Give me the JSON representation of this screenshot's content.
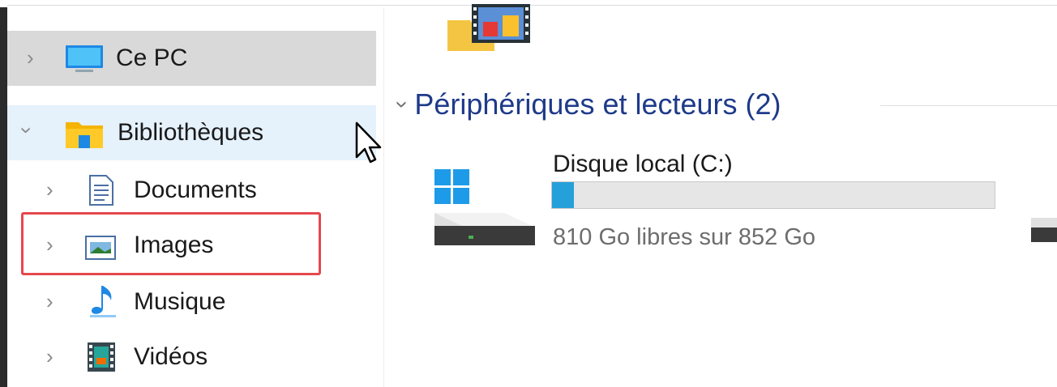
{
  "nav": {
    "items": [
      {
        "label": "Ce PC",
        "icon": "computer-icon",
        "expanded": false,
        "state": "selected"
      },
      {
        "label": "Bibliothèques",
        "icon": "libraries-folder-icon",
        "expanded": true,
        "state": "hover"
      },
      {
        "label": "Documents",
        "icon": "documents-icon",
        "expanded": false
      },
      {
        "label": "Images",
        "icon": "images-icon",
        "expanded": false,
        "highlighted": true
      },
      {
        "label": "Musique",
        "icon": "music-icon",
        "expanded": false
      },
      {
        "label": "Vidéos",
        "icon": "videos-icon",
        "expanded": false
      }
    ]
  },
  "main": {
    "group": {
      "title": "Périphériques et lecteurs (2)"
    },
    "drive": {
      "name": "Disque local (C:)",
      "info": "810 Go libres sur 852 Go",
      "used_fraction": 0.049,
      "icon": "windows-drive-icon"
    }
  },
  "colors": {
    "accent_blue": "#26a0da",
    "group_title": "#1e3a8a",
    "highlight_red": "#e5484d",
    "selected_bg": "#d9d9d9",
    "hover_bg": "#e5f1fb"
  }
}
